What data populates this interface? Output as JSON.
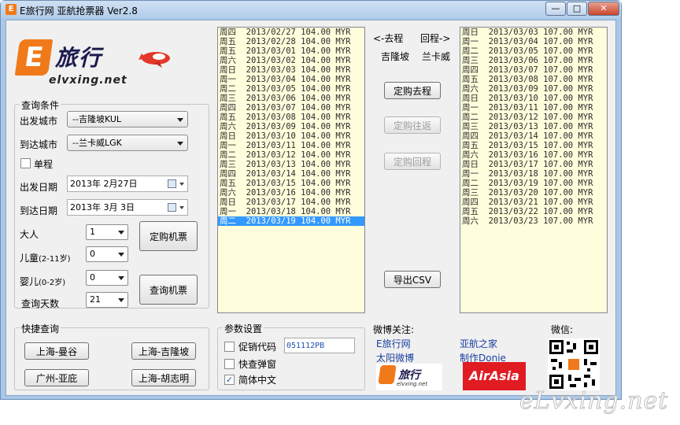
{
  "window": {
    "title": "E旅行网 亚航抢票器 Ver2.8",
    "minimize": "—",
    "maximize": "□",
    "close": "✕"
  },
  "logo": {
    "text": "旅行",
    "domain": "elvxing.net",
    "letter": "E"
  },
  "query": {
    "group_label": "查询条件",
    "depart_city_label": "出发城市",
    "depart_city_value": "--吉隆坡KUL",
    "arrive_city_label": "到达城市",
    "arrive_city_value": "--兰卡威LGK",
    "oneway_label": "单程",
    "oneway_checked": false,
    "depart_date_label": "出发日期",
    "depart_date_value": "2013年  2月27日",
    "arrive_date_label": "到达日期",
    "arrive_date_value": "2013年  3月  3日",
    "adult_label": "大人",
    "adult_value": "1",
    "child_label": "儿童",
    "child_sub": "(2-11岁)",
    "child_value": "0",
    "infant_label": "婴儿",
    "infant_sub": "(0-2岁)",
    "infant_value": "0",
    "days_label": "查询天数",
    "days_value": "21",
    "book_button": "定购机票",
    "search_button": "查询机票"
  },
  "quick": {
    "group_label": "快捷查询",
    "buttons": [
      "上海-曼谷",
      "上海-吉隆坡",
      "广州-亚庇",
      "上海-胡志明"
    ]
  },
  "outbound_list": [
    "周四  2013/02/27 104.00 MYR",
    "周五  2013/02/28 104.00 MYR",
    "周五  2013/03/01 104.00 MYR",
    "周六  2013/03/02 104.00 MYR",
    "周日  2013/03/03 104.00 MYR",
    "周一  2013/03/04 104.00 MYR",
    "周二  2013/03/05 104.00 MYR",
    "周三  2013/03/06 104.00 MYR",
    "周四  2013/03/07 104.00 MYR",
    "周五  2013/03/08 104.00 MYR",
    "周六  2013/03/09 104.00 MYR",
    "周日  2013/03/10 104.00 MYR",
    "周一  2013/03/11 104.00 MYR",
    "周二  2013/03/12 104.00 MYR",
    "周三  2013/03/13 104.00 MYR",
    "周四  2013/03/14 104.00 MYR",
    "周五  2013/03/15 104.00 MYR",
    "周六  2013/03/16 104.00 MYR",
    "周日  2013/03/17 104.00 MYR",
    "周一  2013/03/18 104.00 MYR",
    "周二  2013/03/19 104.00 MYR"
  ],
  "outbound_selected_index": 20,
  "return_list": [
    "周日  2013/03/03 107.00 MYR",
    "周一  2013/03/04 107.00 MYR",
    "周二  2013/03/05 107.00 MYR",
    "周三  2013/03/06 107.00 MYR",
    "周四  2013/03/07 107.00 MYR",
    "周五  2013/03/08 107.00 MYR",
    "周六  2013/03/09 107.00 MYR",
    "周日  2013/03/10 107.00 MYR",
    "周一  2013/03/11 107.00 MYR",
    "周二  2013/03/12 107.00 MYR",
    "周三  2013/03/13 107.00 MYR",
    "周四  2013/03/14 107.00 MYR",
    "周五  2013/03/15 107.00 MYR",
    "周六  2013/03/16 107.00 MYR",
    "周日  2013/03/17 107.00 MYR",
    "周一  2013/03/18 107.00 MYR",
    "周二  2013/03/19 107.00 MYR",
    "周三  2013/03/20 107.00 MYR",
    "周四  2013/03/21 107.00 MYR",
    "周五  2013/03/22 107.00 MYR",
    "周六  2013/03/23 107.00 MYR"
  ],
  "middle": {
    "go_label": "<-去程",
    "return_label": "回程->",
    "go_city": "吉隆坡",
    "return_city": "兰卡威",
    "book_go": "定购去程",
    "book_round": "定购往返",
    "book_return": "定购回程",
    "export_csv": "导出CSV"
  },
  "params": {
    "group_label": "参数设置",
    "promo_label": "促销代码",
    "promo_checked": false,
    "promo_value": "051112PB",
    "popup_label": "快查弹窗",
    "popup_checked": false,
    "chinese_label": "简体中文",
    "chinese_checked": true
  },
  "weibo": {
    "follow_label": "微博关注:",
    "link1": "E旅行网",
    "link2": "太阳微博",
    "airasia_home": "亚航之家",
    "maker": "制作Donie",
    "airasia_logo": "AirAsia",
    "wechat_label": "微信:",
    "logo_text": "旅行",
    "logo_domain": "elvxing.net"
  },
  "watermark": "eLvxing.net",
  "colors": {
    "list_bg": "#fffedc",
    "selection": "#3399ff",
    "accent": "#f07a1a",
    "link": "#1a3fa0",
    "airasia": "#e01b22"
  }
}
